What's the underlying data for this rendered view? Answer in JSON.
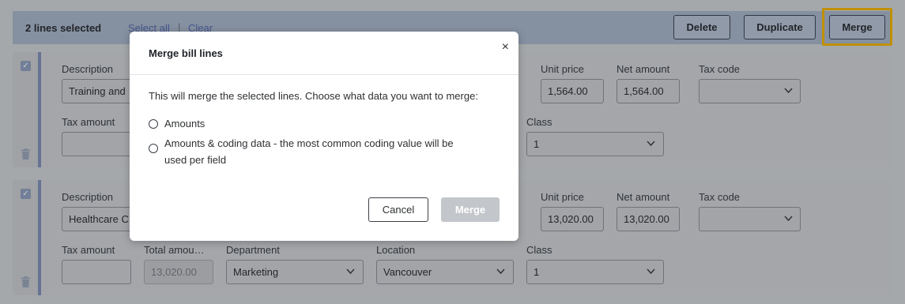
{
  "toolbar": {
    "selection_count": "2 lines selected",
    "select_all": "Select all",
    "separator": "|",
    "clear": "Clear",
    "delete": "Delete",
    "duplicate": "Duplicate",
    "merge": "Merge"
  },
  "labels": {
    "description": "Description",
    "unit_price": "Unit price",
    "net_amount": "Net amount",
    "tax_code": "Tax code",
    "tax_amount": "Tax amount",
    "total_amount": "Total amou…",
    "department": "Department",
    "location": "Location",
    "class": "Class"
  },
  "lines": [
    {
      "description": "Training and",
      "unit_price": "1,564.00",
      "net_amount": "1,564.00",
      "tax_code": "",
      "tax_amount": "",
      "class": "1"
    },
    {
      "description": "Healthcare C",
      "unit_price": "13,020.00",
      "net_amount": "13,020.00",
      "tax_code": "",
      "tax_amount": "",
      "total_amount": "13,020.00",
      "department": "Marketing",
      "location": "Vancouver",
      "class": "1"
    }
  ],
  "modal": {
    "title": "Merge bill lines",
    "close": "×",
    "description": "This will merge the selected lines. Choose what data you want to merge:",
    "options": [
      "Amounts",
      "Amounts & coding data - the most common coding value will be used per field"
    ],
    "cancel": "Cancel",
    "merge": "Merge"
  },
  "colors": {
    "toolbar_bg": "#a7b4c8",
    "highlight": "#f0b400",
    "card_accent": "#8090b8",
    "overlay": "rgba(0,0,0,0.2)"
  }
}
